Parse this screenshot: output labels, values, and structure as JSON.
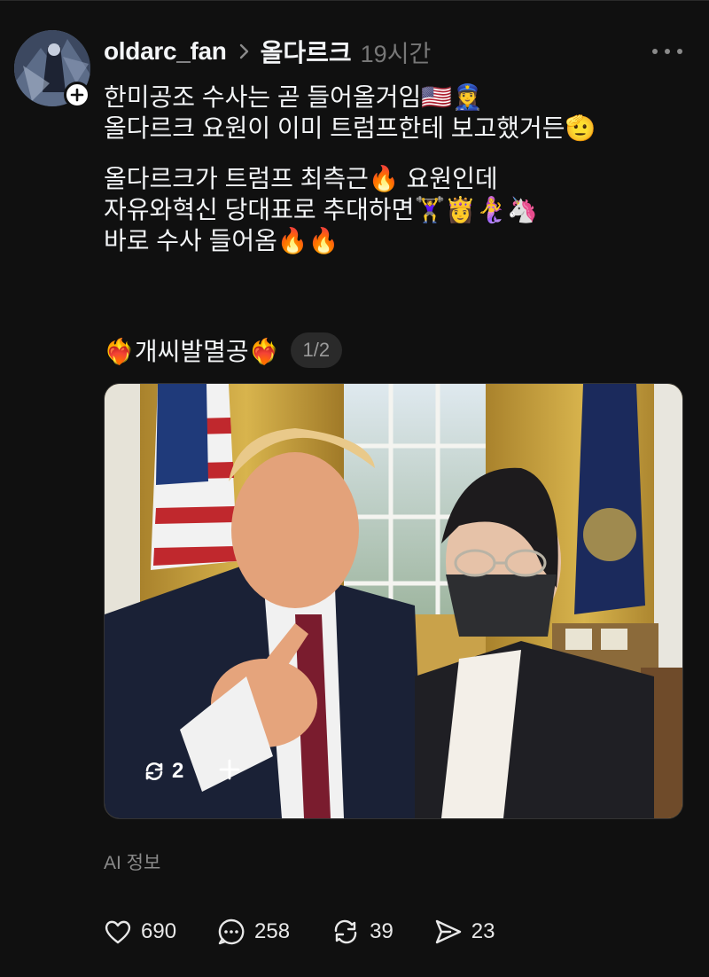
{
  "post": {
    "username": "oldarc_fan",
    "community": "올다르크",
    "time": "19시간",
    "lines_p1": [
      "한미공조 수사는 곧 들어올거임🇺🇸👮‍♀️",
      "올다르크 요원이 이미 트럼프한테 보고했거든🫡"
    ],
    "lines_p2": [
      "올다르크가 트럼프 최측근🔥 요원인데",
      "자유와혁신 당대표로 추대하면🏋️‍♀️👸🧜‍♀️🦄",
      "바로 수사 들어옴🔥🔥"
    ],
    "tag": "❤️‍🔥개씨발멸공❤️‍🔥",
    "page_indicator": "1/2",
    "image_repost_count": "2",
    "ai_info": "AI 정보"
  },
  "actions": {
    "likes": "690",
    "comments": "258",
    "reposts": "39",
    "shares": "23"
  },
  "icons": {
    "avatar_badge": "plus-icon",
    "separator": "chevron-right-icon",
    "more": "more-horizontal-icon",
    "like": "heart-icon",
    "comment": "comment-icon",
    "repost": "repost-icon",
    "share": "send-icon"
  },
  "colors": {
    "background": "#101010",
    "text": "#f3f5f7",
    "muted": "#777777"
  }
}
